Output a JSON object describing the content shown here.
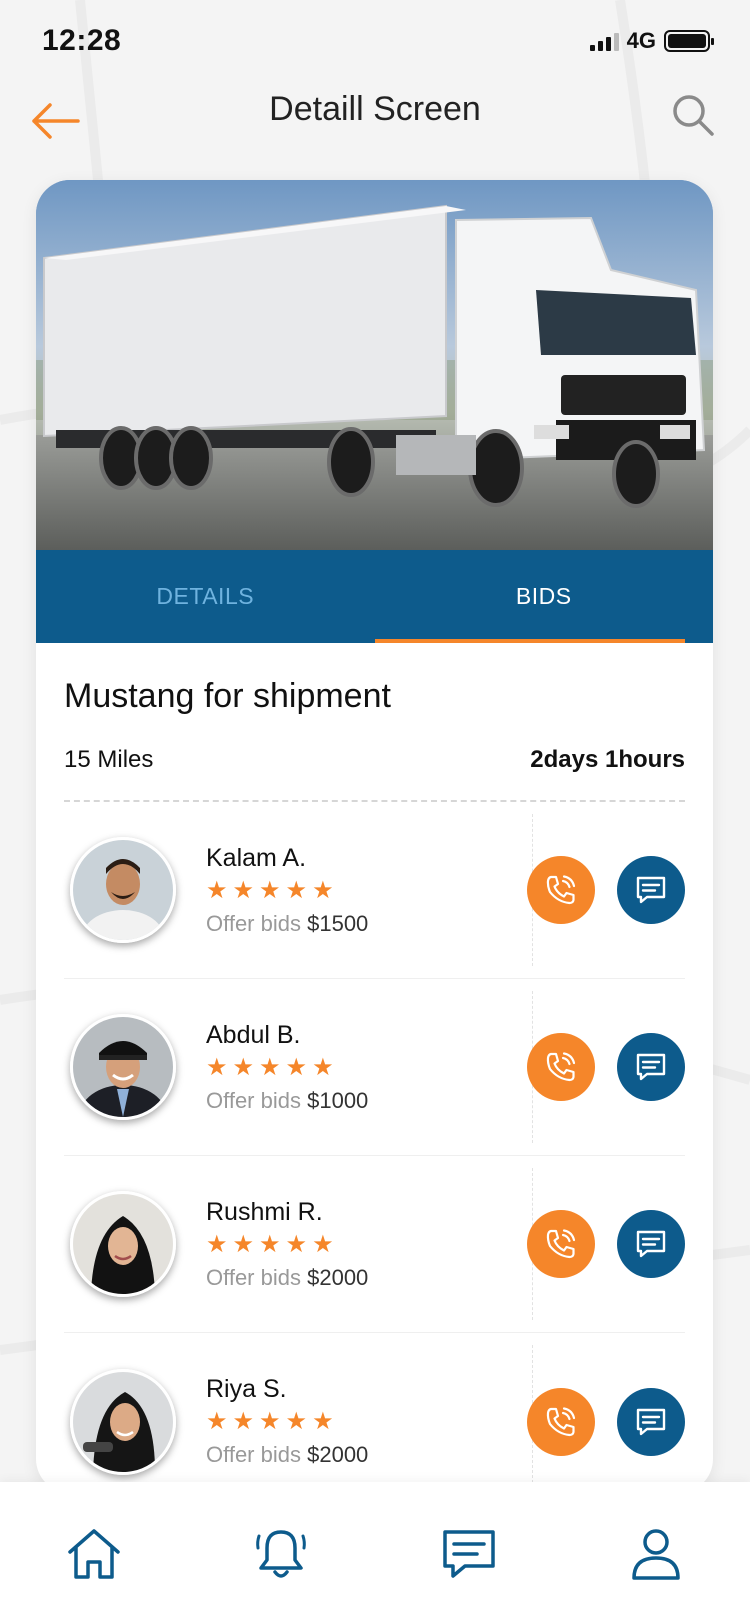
{
  "status_bar": {
    "time": "12:28",
    "network": "4G"
  },
  "header": {
    "title": "Detaill Screen"
  },
  "tabs": [
    {
      "label": "DETAILS",
      "active": false
    },
    {
      "label": "BIDS",
      "active": true
    }
  ],
  "job": {
    "title": "Mustang for shipment",
    "distance": "15 Miles",
    "duration": "2days 1hours"
  },
  "bids": [
    {
      "name": "Kalam A.",
      "offer_label": "Offer bids",
      "amount": "$1500",
      "rating": 5
    },
    {
      "name": "Abdul B.",
      "offer_label": "Offer bids",
      "amount": "$1000",
      "rating": 5
    },
    {
      "name": "Rushmi R.",
      "offer_label": "Offer bids",
      "amount": "$2000",
      "rating": 5
    },
    {
      "name": "Riya S.",
      "offer_label": "Offer bids",
      "amount": "$2000",
      "rating": 5
    }
  ],
  "bottom_nav": [
    "home-icon",
    "bell-icon",
    "chat-icon",
    "user-icon"
  ],
  "colors": {
    "accent_orange": "#f5862a",
    "primary_blue": "#0d5b8c",
    "tab_inactive": "#6fb3df"
  }
}
